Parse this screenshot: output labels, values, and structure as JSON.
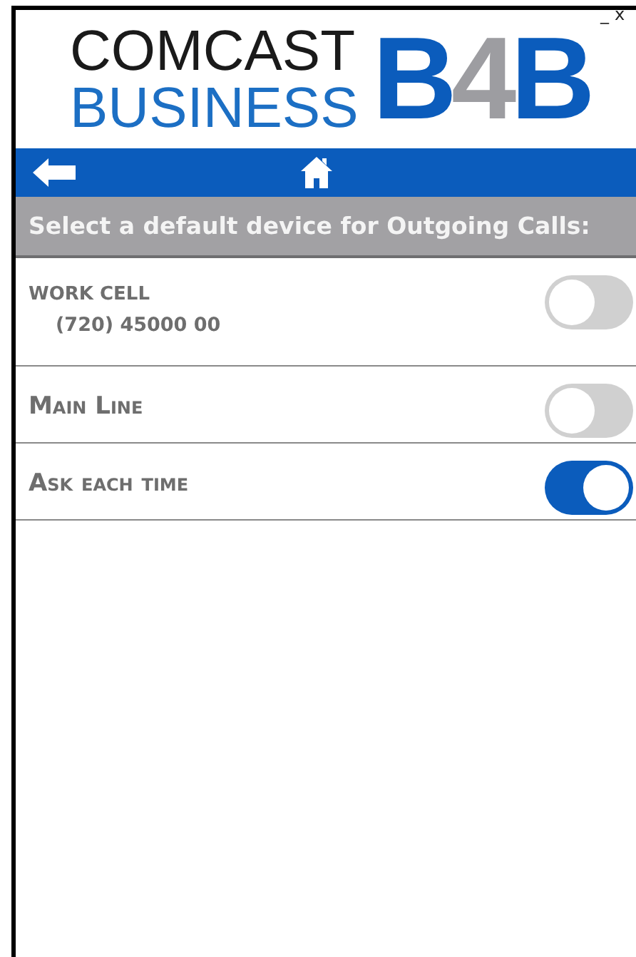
{
  "window_controls": {
    "minimize": "_",
    "close": "x"
  },
  "logo": {
    "line_1": "COMCAST",
    "line_2": "BUSINESS",
    "mark_parts": [
      "B",
      "4",
      "B"
    ]
  },
  "header": "Select a default device for Outgoing Calls:",
  "devices": [
    {
      "label": "WORK CELL",
      "number": "(720) 45000 00",
      "on": false,
      "kind": "caps"
    },
    {
      "label": "Main Line",
      "on": false,
      "kind": "smallcaps"
    },
    {
      "label": "Ask each time",
      "on": true,
      "kind": "smallcaps"
    }
  ]
}
